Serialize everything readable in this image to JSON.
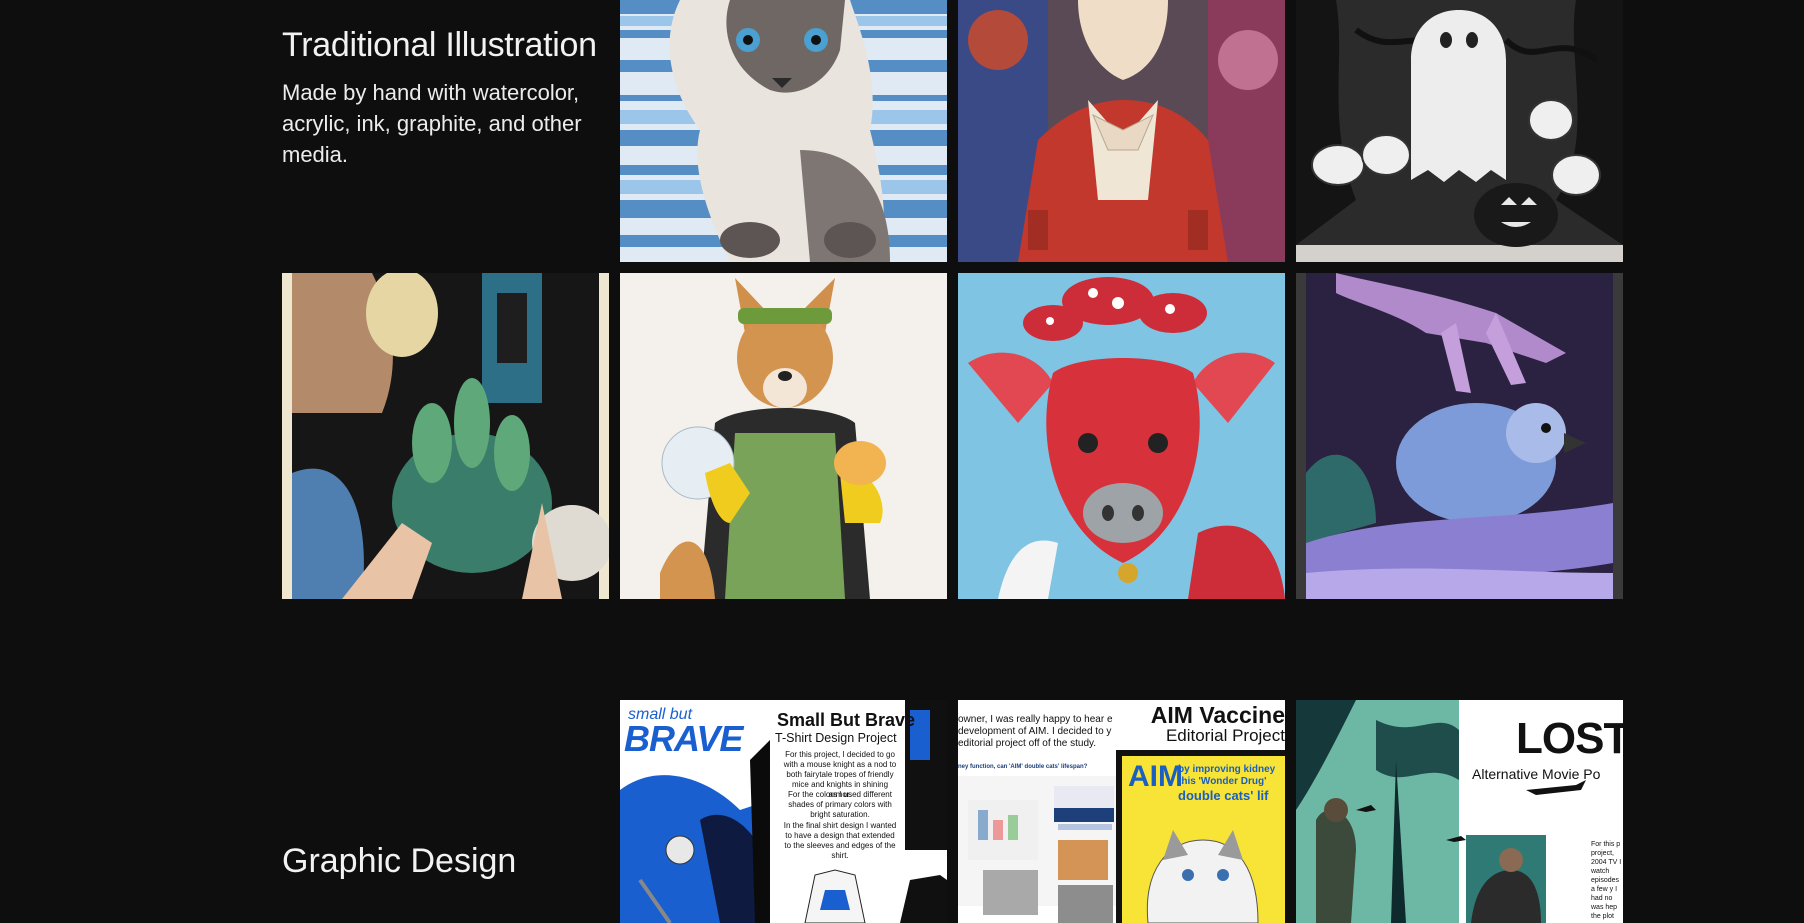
{
  "section_traditional": {
    "title": "Traditional Illustration",
    "description": "Made by hand with watercolor, acrylic, ink, graphite, and other media."
  },
  "section_graphic": {
    "title": "Graphic Design"
  },
  "posters": {
    "brave": {
      "logo_top": "small but",
      "logo_main": "BRAVE",
      "title": "Small But Brave",
      "subtitle": "T-Shirt Design Project",
      "body1": "For this project, I decided to go with a mouse knight as a nod to both fairytale tropes of friendly mice and knights in shining armor.",
      "body2": "For the colors I used different shades of primary colors with bright saturation.",
      "body3": "In the final shirt design I wanted to have a design that extended to the sleeves and edges of the shirt."
    },
    "aim": {
      "title": "AIM Vaccine",
      "subtitle": "Editorial Project",
      "intro": "owner, I was really happy to hear e development of AIM. I decided to y editorial project off of the study.",
      "small_heading": "ney function, can 'AIM' double cats' lifespan?",
      "logo": "AIM",
      "cover_line1": "by improving kidney",
      "cover_line2": "this 'Wonder Drug'",
      "cover_line3": "double cats' lif"
    },
    "lost": {
      "title": "LOST",
      "subtitle": "Alternative Movie Po",
      "side_text": "For this p project, 2004 TV I watch episodes a few y I had no was hep the plot"
    }
  },
  "colors": {
    "background": "#0e0e0f",
    "text": "#f2f2f2"
  }
}
